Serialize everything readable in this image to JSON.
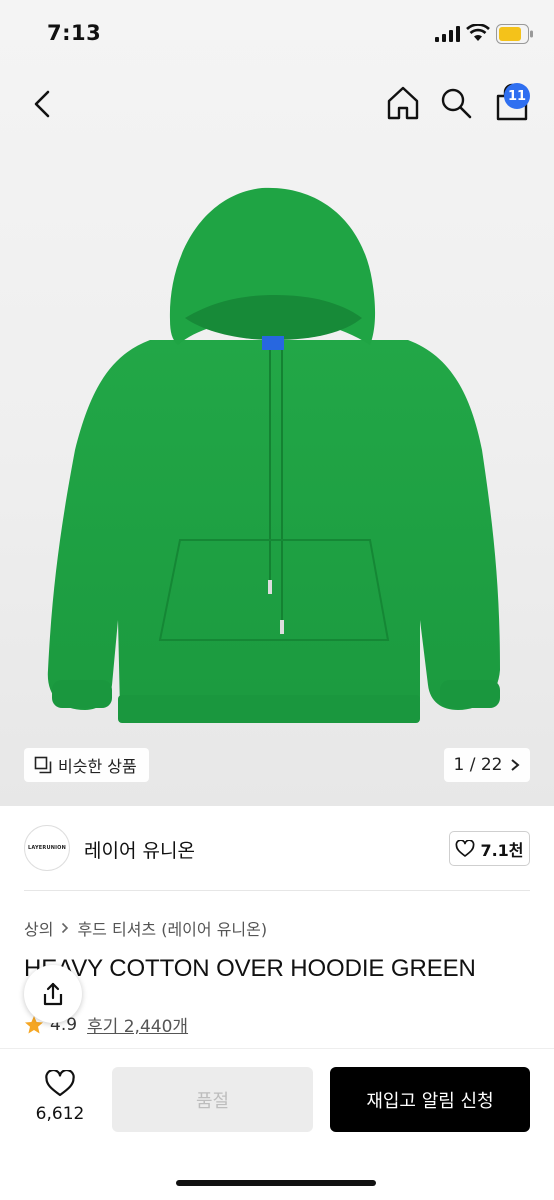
{
  "status_bar": {
    "time": "7:13"
  },
  "nav": {
    "cart_count": "11"
  },
  "image": {
    "similar_label": "비슷한 상품",
    "page_indicator": "1 / 22",
    "hoodie_color": "#1da343"
  },
  "brand": {
    "name": "레이어 유니온",
    "logo_text": "LAYERUNION",
    "likes": "7.1천"
  },
  "breadcrumb": {
    "level1": "상의",
    "level2": "후드 티셔츠 (레이어 유니온)"
  },
  "product": {
    "title": "HEAVY COTTON OVER HOODIE GREEN",
    "rating": "4.9",
    "reviews": "후기 2,440개"
  },
  "bottom": {
    "wish_count": "6,612",
    "soldout_label": "품절",
    "restock_label": "재입고 알림 신청"
  },
  "colors": {
    "accent_badge": "#2f6ff0",
    "star": "#f5a623",
    "primary_button": "#000000"
  }
}
